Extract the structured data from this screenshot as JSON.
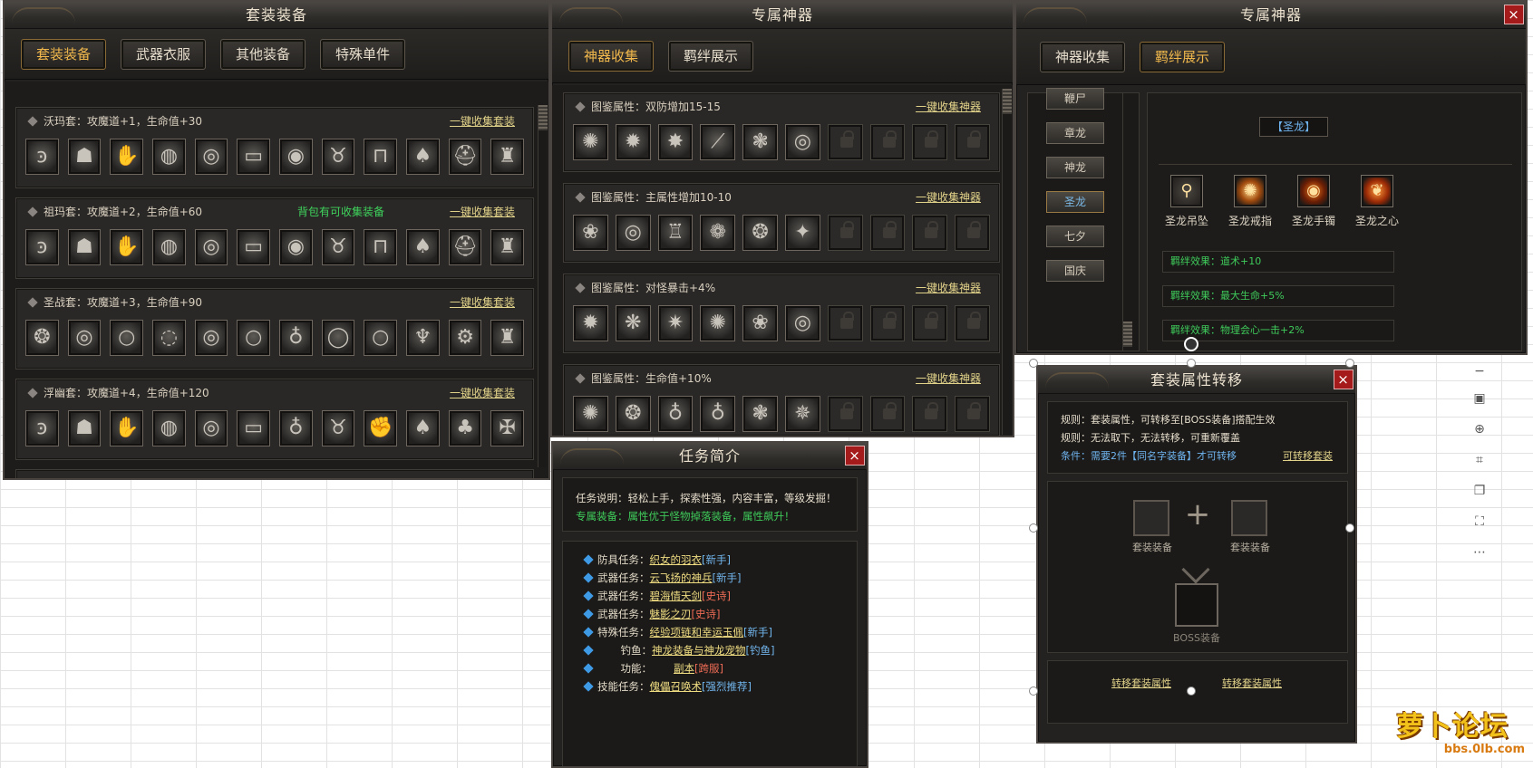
{
  "suit_panel": {
    "title": "套装装备",
    "tabs": [
      "套装装备",
      "武器衣服",
      "其他装备",
      "特殊单件"
    ],
    "rows": [
      {
        "label": "沃玛套：攻魔道+1，生命值+30",
        "note": "",
        "link": "一键收集套装"
      },
      {
        "label": "祖玛套：攻魔道+2，生命值+60",
        "note": "背包有可收集装备",
        "link": "一键收集套装"
      },
      {
        "label": "圣战套：攻魔道+3，生命值+90",
        "note": "",
        "link": "一键收集套装"
      },
      {
        "label": "浮幽套：攻魔道+4，生命值+120",
        "note": "",
        "link": "一键收集套装"
      }
    ]
  },
  "artifact_panel": {
    "title": "专属神器",
    "tabs": [
      "神器收集",
      "羁绊展示"
    ],
    "rows": [
      {
        "label": "图鉴属性：双防增加15-15",
        "link": "一键收集神器"
      },
      {
        "label": "图鉴属性：主属性增加10-10",
        "link": "一键收集神器"
      },
      {
        "label": "图鉴属性：对怪暴击+4%",
        "link": "一键收集神器"
      },
      {
        "label": "图鉴属性：生命值+10%",
        "link": "一键收集神器"
      }
    ]
  },
  "bond_panel": {
    "title": "专属神器",
    "close": "×",
    "tabs": [
      "神器收集",
      "羁绊展示"
    ],
    "names": [
      "鞭尸",
      "章龙",
      "神龙",
      "圣龙",
      "七夕",
      "国庆"
    ],
    "selected_title": "【圣龙】",
    "items": [
      "圣龙吊坠",
      "圣龙戒指",
      "圣龙手镯",
      "圣龙之心"
    ],
    "effects": [
      "羁绊效果：道术+10",
      "羁绊效果：最大生命+5%",
      "羁绊效果：物理会心一击+2%"
    ]
  },
  "task_panel": {
    "title": "任务简介",
    "close": "×",
    "desc1": "任务说明：轻松上手，探索性强，内容丰富，等级发掘！",
    "desc2": "专属装备：属性优于怪物掉落装备，属性飙升！",
    "tasks": [
      {
        "type": "防具任务：",
        "name": "织女的羽衣",
        "tag": "[新手]",
        "tag_color": "blue"
      },
      {
        "type": "武器任务：",
        "name": "云飞扬的神兵",
        "tag": "[新手]",
        "tag_color": "blue"
      },
      {
        "type": "武器任务：",
        "name": "碧海情天剑",
        "tag": "[史诗]",
        "tag_color": "red"
      },
      {
        "type": "武器任务：",
        "name": "魅影之刃",
        "tag": "[史诗]",
        "tag_color": "red"
      },
      {
        "type": "特殊任务：",
        "name": "经验项链和幸运玉佩",
        "tag": "[新手]",
        "tag_color": "blue"
      },
      {
        "type": "钓鱼：",
        "name": "神龙装备与神龙宠物",
        "tag": "[钓鱼]",
        "tag_color": "blue"
      },
      {
        "type": "功能：",
        "name": "副本",
        "tag": "[跨服]",
        "tag_color": "red"
      },
      {
        "type": "技能任务：",
        "name": "傀儡召唤术",
        "tag": "[强烈推荐]",
        "tag_color": "blue"
      }
    ]
  },
  "transfer_panel": {
    "title": "套装属性转移",
    "close": "×",
    "rule1": "规则：套装属性，可转移至[BOSS装备]搭配生效",
    "rule2": "规则：无法取下，无法转移，可重新覆盖",
    "condition": "条件：需要2件【同名字装备】才可转移",
    "link": "可转移套装",
    "slot_label_a": "套装装备",
    "slot_label_b": "套装装备",
    "plus": "+",
    "result_label": "BOSS装备",
    "btn1": "转移套装属性",
    "btn2": "转移套装属性"
  },
  "watermark": {
    "logo": "萝卜论坛",
    "url": "bbs.0lb.com"
  },
  "colors": {
    "panel_bg": "#232220",
    "link": "#e2d38a",
    "green": "#3ed35c",
    "tab_active": "#f0b84c"
  }
}
